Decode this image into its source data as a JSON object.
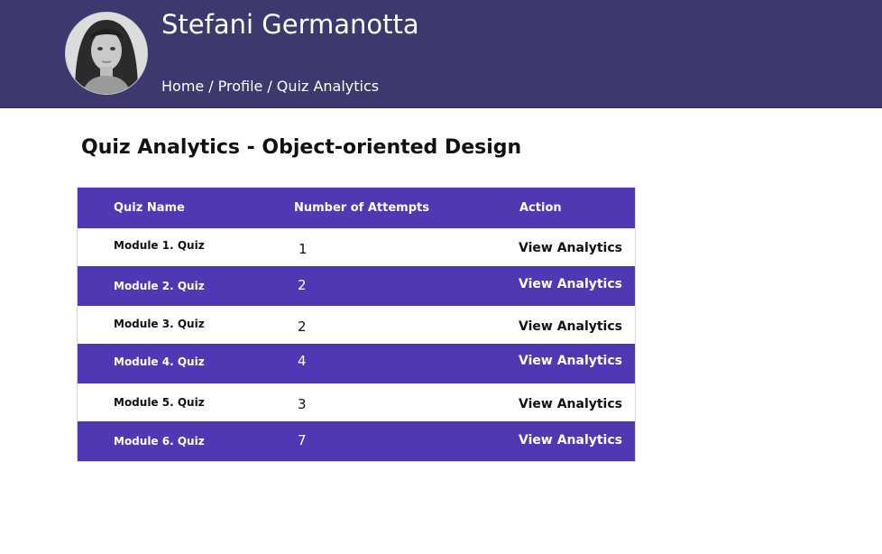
{
  "header": {
    "user_name": "Stefani Germanotta",
    "avatar_icon": "user-portrait",
    "breadcrumb": [
      "Home",
      "Profile",
      "Quiz Analytics"
    ],
    "background": "#3d396e"
  },
  "page": {
    "title": "Quiz Analytics - Object-oriented Design"
  },
  "table": {
    "accent": "#5037b3",
    "columns": [
      "Quiz Name",
      "Number of Attempts",
      "Action"
    ],
    "rows": [
      {
        "name": "Module 1. Quiz",
        "attempts": "1",
        "action": "View Analytics"
      },
      {
        "name": "Module 2. Quiz",
        "attempts": "2",
        "action": "View Analytics"
      },
      {
        "name": "Module 3. Quiz",
        "attempts": "2",
        "action": "View Analytics"
      },
      {
        "name": "Module 4. Quiz",
        "attempts": "4",
        "action": "View Analytics"
      },
      {
        "name": "Module 5. Quiz",
        "attempts": "3",
        "action": "View Analytics"
      },
      {
        "name": "Module 6. Quiz",
        "attempts": "7",
        "action": "View Analytics"
      }
    ]
  }
}
